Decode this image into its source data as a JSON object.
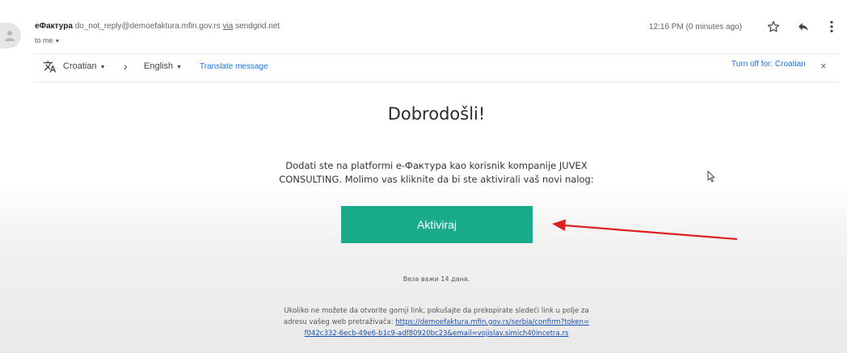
{
  "header": {
    "sender_name": "eФактура",
    "sender_email": "do_not_reply@demoefaktura.mfin.gov.rs",
    "via_label": "via",
    "via_domain": "sendgrid.net",
    "to_label": "to me",
    "time": "12:16 PM (0 minutes ago)"
  },
  "translate_bar": {
    "source_language": "Croatian",
    "target_language": "English",
    "translate_link": "Translate message",
    "turn_off_link": "Turn off for: Croatian"
  },
  "email_body": {
    "heading": "Dobrodošli!",
    "message_line1": "Dodati ste na platformi e-Фактура kao korisnik kompanije JUVEX",
    "message_line2": "CONSULTING. Molimo vas kliknite da bi ste aktivirali vaš novi nalog:",
    "activate_button": "Aktiviraj",
    "validity_note": "Веза важи 14 дана.",
    "fallback_line1": "Ukoliko ne možete da otvorite gornji link, pokušajte da prekopirate sledeći link u polje za",
    "fallback_line2_prefix": "adresu vašeg web pretraživača: ",
    "fallback_link_part1": "https://demoefaktura.mfin.gov.rs/serbia/confirm?token=",
    "fallback_link_part2": "f042c332-6ecb-49e6-b1c9-adf80920bc23&email=vojislav.simich40incetra.rs"
  },
  "colors": {
    "button": "#1aab8c",
    "link": "#1a73e8",
    "annotation_arrow": "#e02020"
  },
  "icons": [
    "person-avatar-icon",
    "star-icon",
    "reply-icon",
    "more-vert-icon",
    "translate-icon",
    "chevron-right-icon",
    "close-icon",
    "mouse-cursor-icon"
  ]
}
